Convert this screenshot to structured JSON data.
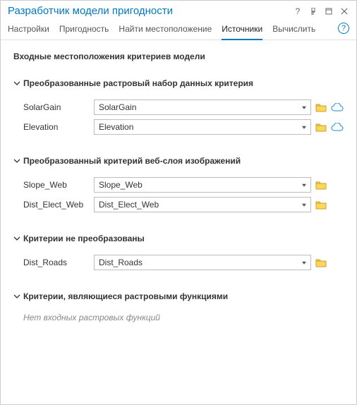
{
  "titlebar": {
    "title": "Разработчик модели пригодности",
    "help_symbol": "?"
  },
  "tabs": {
    "items": [
      "Настройки",
      "Пригодность",
      "Найти местоположение",
      "Источники",
      "Вычислить"
    ],
    "active_index": 3,
    "help_symbol": "?"
  },
  "content": {
    "heading": "Входные местоположения критериев модели",
    "sections": [
      {
        "title": "Преобразованные растровый набор данных критерия",
        "rows": [
          {
            "label": "SolarGain",
            "value": "SolarGain",
            "cloud": true
          },
          {
            "label": "Elevation",
            "value": "Elevation",
            "cloud": true
          }
        ]
      },
      {
        "title": "Преобразованный критерий веб-слоя изображений",
        "rows": [
          {
            "label": "Slope_Web",
            "value": "Slope_Web",
            "cloud": false
          },
          {
            "label": "Dist_Elect_Web",
            "value": "Dist_Elect_Web",
            "cloud": false
          }
        ]
      },
      {
        "title": "Критерии не преобразованы",
        "rows": [
          {
            "label": "Dist_Roads",
            "value": "Dist_Roads",
            "cloud": false
          }
        ]
      },
      {
        "title": "Критерии, являющиеся растровыми функциями",
        "empty": "Нет входных растровых функций"
      }
    ]
  }
}
